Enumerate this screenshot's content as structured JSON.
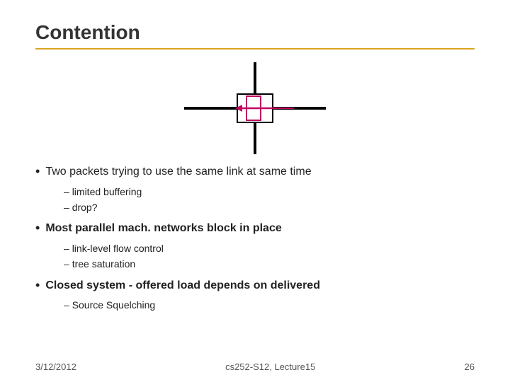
{
  "title": "Contention",
  "footer": {
    "date": "3/12/2012",
    "course": "cs252-S12, Lecture15",
    "page": "26"
  },
  "bullets": [
    {
      "id": "b1",
      "bold": false,
      "text": "Two packets trying to use the same link at same time",
      "subs": [
        "limited buffering",
        "drop?"
      ]
    },
    {
      "id": "b2",
      "bold": true,
      "text": "Most parallel mach. networks block in place",
      "subs": [
        "link-level flow control",
        "tree saturation"
      ]
    },
    {
      "id": "b3",
      "bold": true,
      "text": "Closed system - offered load depends on delivered",
      "subs": [
        "Source Squelching"
      ]
    }
  ]
}
